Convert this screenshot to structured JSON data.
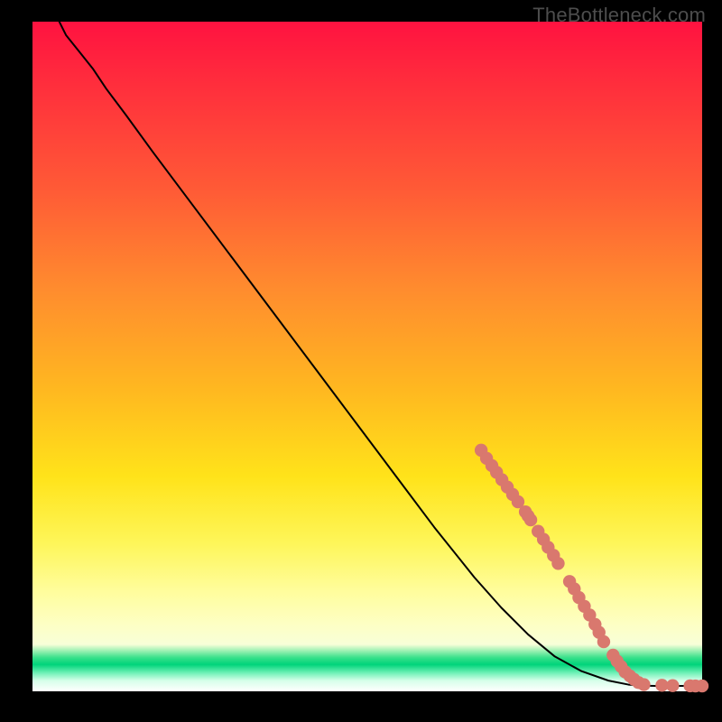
{
  "watermark": "TheBottleneck.com",
  "colors": {
    "curve": "#000000",
    "dot_fill": "#d9786e",
    "dot_stroke": "#d9786e"
  },
  "chart_data": {
    "type": "line",
    "title": "",
    "xlabel": "",
    "ylabel": "",
    "xlim": [
      0,
      100
    ],
    "ylim": [
      0,
      100
    ],
    "grid": false,
    "legend": false,
    "series": [
      {
        "name": "curve",
        "kind": "line",
        "x": [
          4,
          5,
          7,
          9,
          11,
          14,
          18,
          24,
          30,
          36,
          42,
          48,
          54,
          60,
          66,
          70,
          74,
          78,
          82,
          86,
          89,
          91,
          93,
          95,
          97,
          99,
          100
        ],
        "y": [
          100,
          98,
          95.5,
          93,
          90,
          86,
          80.5,
          72.5,
          64.5,
          56.5,
          48.5,
          40.5,
          32.5,
          24.5,
          17,
          12.5,
          8.5,
          5.2,
          3.0,
          1.6,
          1.0,
          0.85,
          0.8,
          0.8,
          0.8,
          0.8,
          0.8
        ]
      },
      {
        "name": "dots",
        "kind": "scatter",
        "points": [
          {
            "x": 67.0,
            "y": 36.0
          },
          {
            "x": 67.8,
            "y": 34.8
          },
          {
            "x": 68.6,
            "y": 33.7
          },
          {
            "x": 69.3,
            "y": 32.7
          },
          {
            "x": 70.1,
            "y": 31.6
          },
          {
            "x": 70.9,
            "y": 30.5
          },
          {
            "x": 71.7,
            "y": 29.4
          },
          {
            "x": 72.5,
            "y": 28.3
          },
          {
            "x": 73.6,
            "y": 26.8
          },
          {
            "x": 74.0,
            "y": 26.2
          },
          {
            "x": 74.4,
            "y": 25.6
          },
          {
            "x": 75.5,
            "y": 23.9
          },
          {
            "x": 76.3,
            "y": 22.7
          },
          {
            "x": 77.0,
            "y": 21.5
          },
          {
            "x": 77.8,
            "y": 20.3
          },
          {
            "x": 78.5,
            "y": 19.1
          },
          {
            "x": 80.2,
            "y": 16.4
          },
          {
            "x": 80.9,
            "y": 15.3
          },
          {
            "x": 81.6,
            "y": 14.0
          },
          {
            "x": 82.4,
            "y": 12.7
          },
          {
            "x": 83.2,
            "y": 11.4
          },
          {
            "x": 84.0,
            "y": 10.0
          },
          {
            "x": 84.6,
            "y": 8.8
          },
          {
            "x": 85.3,
            "y": 7.4
          },
          {
            "x": 86.7,
            "y": 5.4
          },
          {
            "x": 87.3,
            "y": 4.5
          },
          {
            "x": 87.9,
            "y": 3.7
          },
          {
            "x": 88.5,
            "y": 2.9
          },
          {
            "x": 89.2,
            "y": 2.3
          },
          {
            "x": 89.8,
            "y": 1.8
          },
          {
            "x": 90.5,
            "y": 1.3
          },
          {
            "x": 91.3,
            "y": 1.0
          },
          {
            "x": 94.0,
            "y": 0.9
          },
          {
            "x": 95.6,
            "y": 0.85
          },
          {
            "x": 98.2,
            "y": 0.82
          },
          {
            "x": 99.0,
            "y": 0.8
          },
          {
            "x": 100.0,
            "y": 0.8
          }
        ]
      }
    ]
  }
}
